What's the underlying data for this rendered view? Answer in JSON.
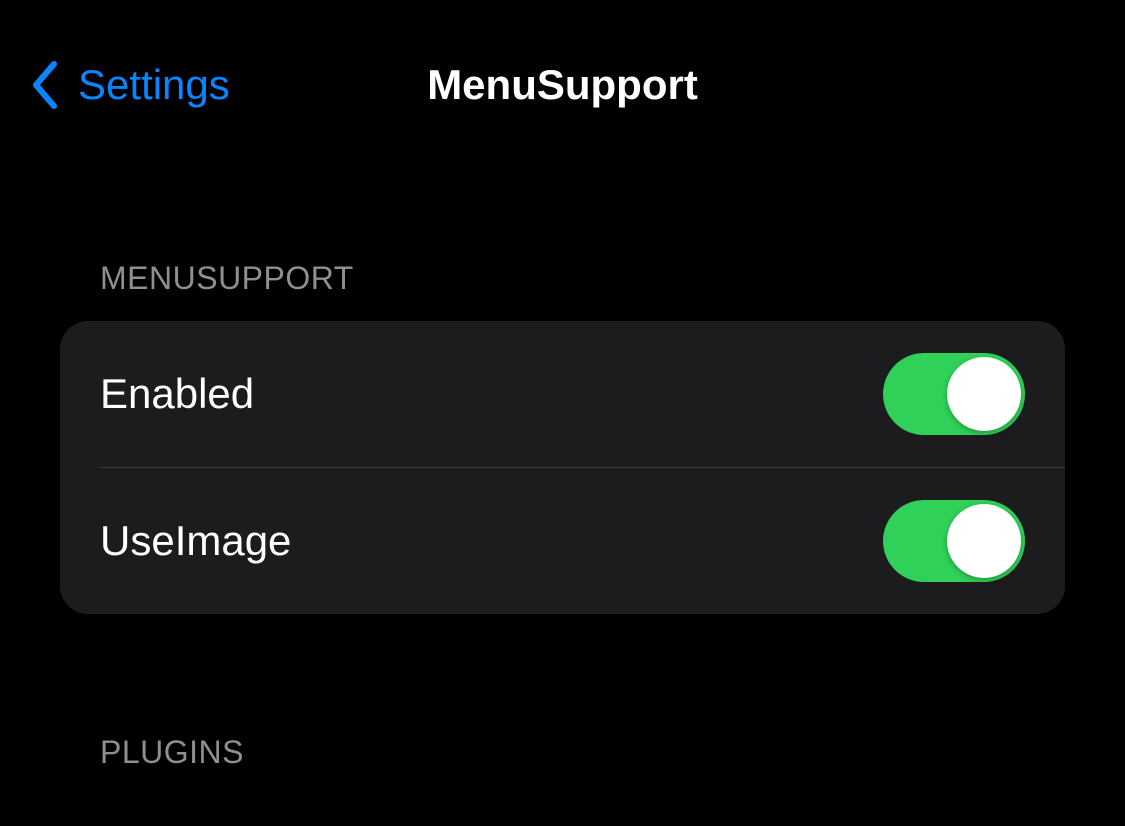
{
  "nav": {
    "back_label": "Settings",
    "title": "MenuSupport"
  },
  "sections": {
    "menusupport": {
      "header": "MENUSUPPORT",
      "rows": [
        {
          "label": "Enabled",
          "value": true
        },
        {
          "label": "UseImage",
          "value": true
        }
      ]
    },
    "plugins": {
      "header": "PLUGINS"
    }
  }
}
